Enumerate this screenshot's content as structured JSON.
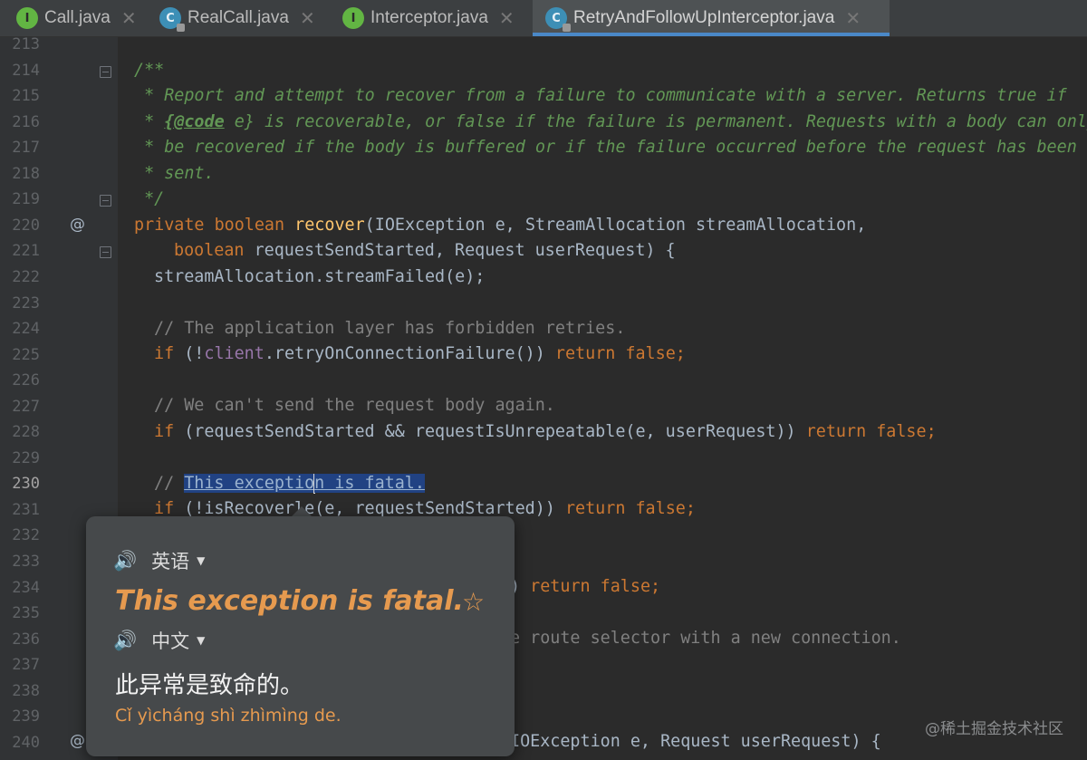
{
  "tabs": [
    {
      "label": "Call.java",
      "icon": "interface-icon",
      "glyph": "I"
    },
    {
      "label": "RealCall.java",
      "icon": "class-icon",
      "glyph": "C"
    },
    {
      "label": "Interceptor.java",
      "icon": "interface-icon",
      "glyph": "I"
    },
    {
      "label": "RetryAndFollowUpInterceptor.java",
      "icon": "class-icon",
      "glyph": "C",
      "active": true
    }
  ],
  "tab_close": "✕",
  "line_numbers": [
    "213",
    "214",
    "215",
    "216",
    "217",
    "218",
    "219",
    "220",
    "221",
    "222",
    "223",
    "224",
    "225",
    "226",
    "227",
    "228",
    "229",
    "230",
    "231",
    "232",
    "233",
    "234",
    "235",
    "236",
    "237",
    "238",
    "239",
    "240"
  ],
  "current_line": "230",
  "gutter_marks": {
    "override_symbol": "@"
  },
  "code": {
    "l214": "/**",
    "l215": " * Report and attempt to recover from a failure to communicate with a server. Returns true if",
    "l216_a": " * ",
    "l216_tag": "{@code",
    "l216_b": " e}",
    "l216_c": " is recoverable, or false if the failure is permanent. Requests with a body can only",
    "l217": " * be recovered if the body is buffered or if the failure occurred before the request has been",
    "l218": " * sent.",
    "l219": " */",
    "l220_kw": "private boolean ",
    "l220_fn": "recover",
    "l220_rest": "(IOException e, StreamAllocation streamAllocation,",
    "l221_kw": "boolean ",
    "l221_rest": "requestSendStarted, Request userRequest) {",
    "l222": "streamAllocation.streamFailed(e);",
    "l224": "// The application layer has forbidden retries.",
    "l225_kw": "if ",
    "l225_a": "(!",
    "l225_fld": "client",
    "l225_b": ".retryOnConnectionFailure()) ",
    "l225_ret": "return false;",
    "l227": "// We can't send the request body again.",
    "l228_kw": "if ",
    "l228_a": "(requestSendStarted && requestIsUnrepeatable(e, userRequest)) ",
    "l228_ret": "return false;",
    "l230_cm": "// ",
    "l230_sel_a": "This exceptio",
    "l230_sel_b": "n is fatal.",
    "l231_kw": "if ",
    "l231_a": "(!isRecover",
    "l231_b": "le(e, requestSendStarted)) ",
    "l231_ret": "return false;",
    "l234_a": ") ",
    "l234_ret": "return false;",
    "l236": "e route selector with a new connection.",
    "l240": "IOException e, Request userRequest) {"
  },
  "translate_popup": {
    "source_lang": "英语",
    "target_lang": "中文",
    "source_text": "This exception is fatal.",
    "translation": "此异常是致命的。",
    "pinyin": "Cǐ yìcháng shì zhìmìng de.",
    "speaker_icon": "🔊",
    "star_icon": "☆",
    "dropdown_icon": "▼"
  },
  "watermark": "@稀土掘金技术社区",
  "colors": {
    "background": "#2b2b2b",
    "keyword": "#cc7832",
    "function": "#ffc66d",
    "javadoc": "#629755",
    "comment": "#808080",
    "field": "#9876aa",
    "selection": "#214283",
    "accent": "#e69a4f"
  }
}
